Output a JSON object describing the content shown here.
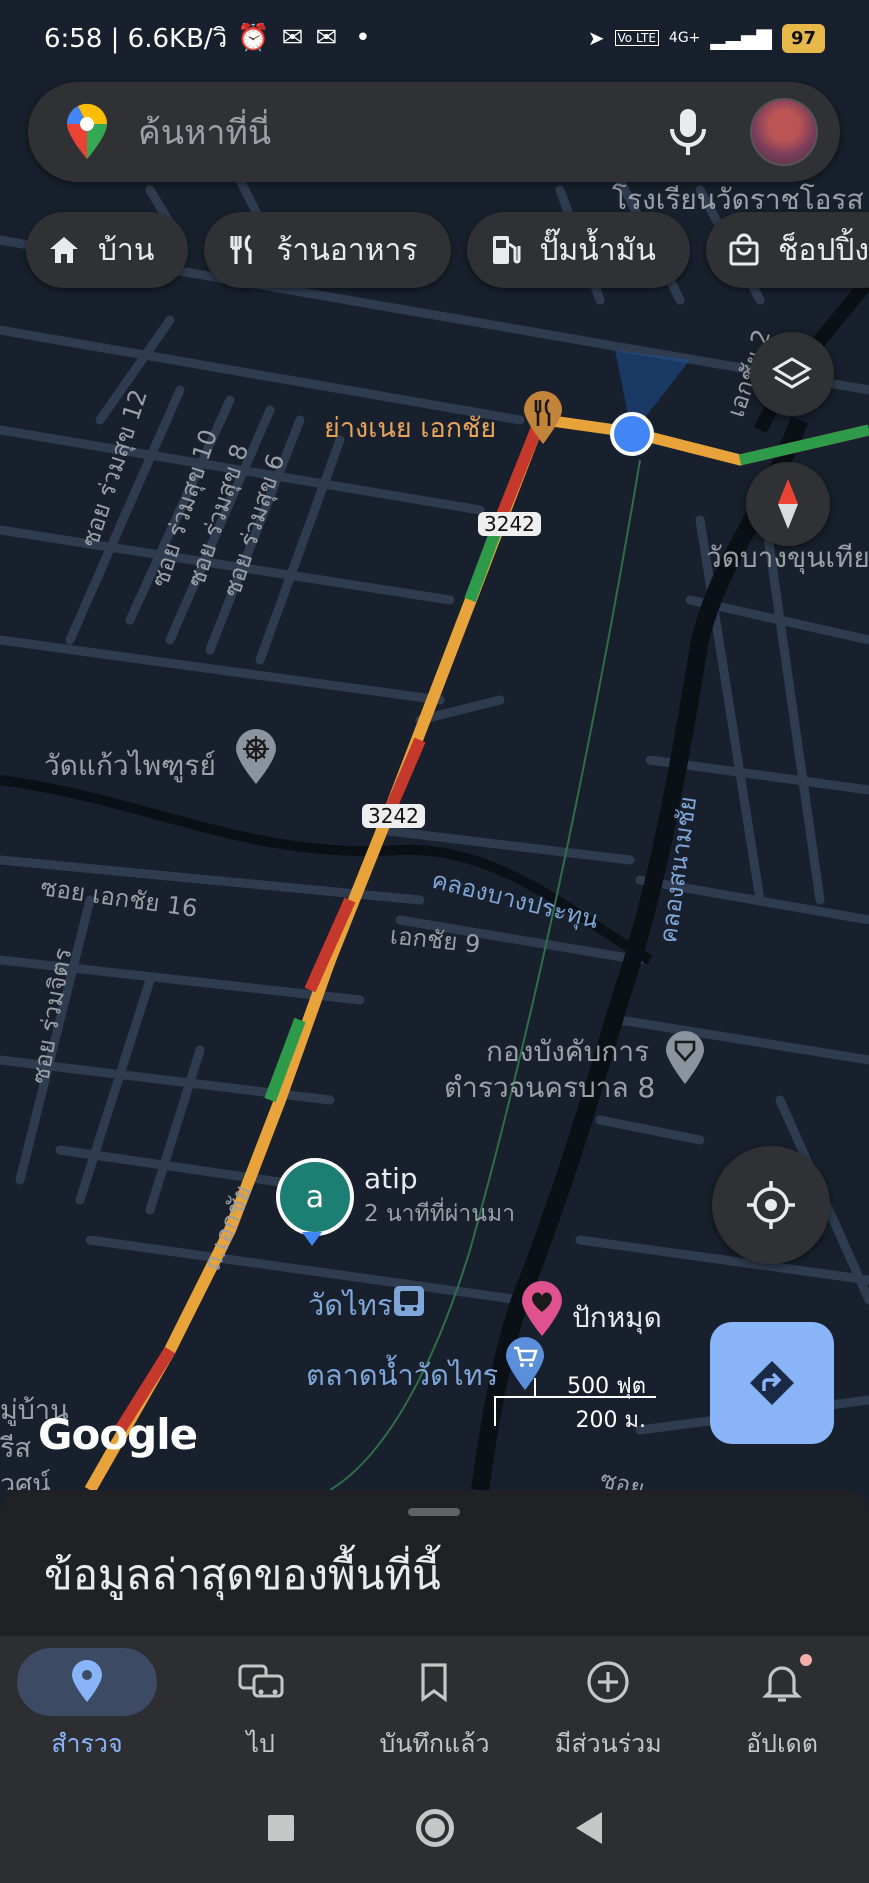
{
  "status_bar": {
    "time_speed": "6:58 | 6.6KB/วิ",
    "battery": "97",
    "network": "4G+",
    "volte": "Vo LTE"
  },
  "search": {
    "placeholder": "ค้นหาที่นี่"
  },
  "chips": [
    {
      "label": "บ้าน",
      "icon": "home-icon"
    },
    {
      "label": "ร้านอาหาร",
      "icon": "restaurant-icon"
    },
    {
      "label": "ปั๊มน้ำมัน",
      "icon": "gas-station-icon"
    },
    {
      "label": "ช็อปปิ้ง",
      "icon": "shopping-icon"
    }
  ],
  "map": {
    "poi_restaurant": "ย่างเนย เอกชัย",
    "poi_school": "โรงเรียนวัดราชโอรส",
    "poi_temple_right": "วัดบางขุนเทียน",
    "poi_temple_left": "วัดแก้วไพฑูรย์",
    "poi_police_1": "กองบังคับการ",
    "poi_police_2": "ตำรวจนครบาล 8",
    "poi_wat_sai": "วัดไทร",
    "poi_market": "ตลาดน้ำวัดไทร",
    "poi_pin": "ปักหมุด",
    "poi_home_1": "มู่บ้าน",
    "poi_home_2": "รีส",
    "poi_home_3": "วศน์",
    "road_3242_a": "3242",
    "road_3242_b": "3242",
    "road_soi_12": "ซอย ร่วมสุข 12",
    "road_soi_10": "ซอย ร่วมสุข 10",
    "road_soi_8": "ซอย ร่วมสุข 8",
    "road_soi_6": "ซอย ร่วมสุข 6",
    "road_ekachai16": "ซอย เอกชัย 16",
    "road_ekachai9": "เอกชัย 9",
    "road_ekachai2": "เอกชัย 2",
    "road_ekachai_main": "ถ.เอกชัย",
    "road_ruamjit": "ซอย ร่วมจิตร",
    "canal_bangprathun": "คลองบางประทุน",
    "canal_sanamchai": "คลองสนามชัย",
    "road_soi_bottom": "ซอย",
    "friend_initial": "a",
    "friend_name": "atip",
    "friend_time": "2 นาทีที่ผ่านมา",
    "scale_ft": "500 ฟุต",
    "scale_m": "200 ม.",
    "google_logo": "Google"
  },
  "sheet": {
    "title": "ข้อมูลล่าสุดของพื้นที่นี้"
  },
  "nav": [
    {
      "label": "สำรวจ",
      "icon": "location-pin-icon",
      "active": true
    },
    {
      "label": "ไป",
      "icon": "commute-icon",
      "active": false
    },
    {
      "label": "บันทึกแล้ว",
      "icon": "bookmark-icon",
      "active": false
    },
    {
      "label": "มีส่วนร่วม",
      "icon": "add-circle-icon",
      "active": false
    },
    {
      "label": "อัปเดต",
      "icon": "bell-icon",
      "active": false
    }
  ],
  "colors": {
    "accent": "#8ab4f8",
    "traffic_green": "#2e9b4a",
    "traffic_orange": "#e8a33a",
    "traffic_red": "#c5392d",
    "pin_pink": "#e0528e",
    "restaurant": "#c2843a"
  }
}
